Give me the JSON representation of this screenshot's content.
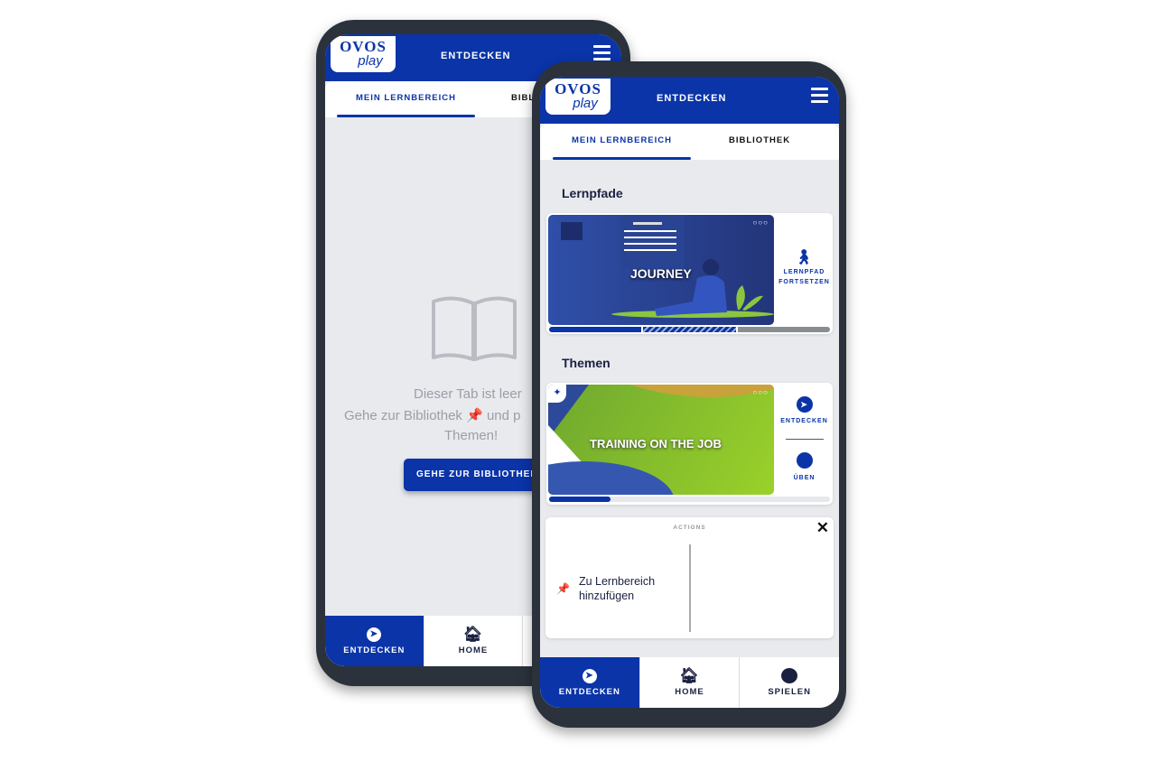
{
  "back_phone": {
    "header": {
      "logo_top": "OVOS",
      "logo_bottom": "play",
      "title": "ENTDECKEN"
    },
    "tabs": [
      {
        "label": "MEIN LERNBEREICH",
        "active": true
      },
      {
        "label": "BIBLIOTHEK",
        "active": false
      }
    ],
    "empty": {
      "line1": "Dieser Tab ist leer",
      "line2a": "Gehe zur Bibliothek",
      "line2b": "und p",
      "line3": "Themen!",
      "icon": "open-book-icon"
    },
    "button": "GEHE ZUR BIBLIOTHEK",
    "nav": [
      {
        "label": "ENTDECKEN",
        "icon": "compass-icon",
        "active": true
      },
      {
        "label": "HOME",
        "icon": "home-icon",
        "active": false
      }
    ]
  },
  "front_phone": {
    "header": {
      "logo_top": "OVOS",
      "logo_bottom": "play",
      "title": "ENTDECKEN"
    },
    "tabs": [
      {
        "label": "MEIN LERNBEREICH",
        "active": true
      },
      {
        "label": "BIBLIOTHEK",
        "active": false
      }
    ],
    "sections": {
      "lernpfade": "Lernpfade",
      "themen": "Themen"
    },
    "journey_card": {
      "title": "JOURNEY",
      "action": "LERNPFAD FORTSETZEN",
      "action_icon": "hiker-icon",
      "progress_segments": [
        "done",
        "in-progress",
        "todo"
      ]
    },
    "topic_card": {
      "title": "TRAINING ON THE JOB",
      "actions": [
        {
          "label": "ENTDECKEN",
          "icon": "compass-icon"
        },
        {
          "label": "ÜBEN",
          "icon": "brain-icon"
        }
      ],
      "progress": 0.22
    },
    "actions_panel": {
      "title": "ACTIONS",
      "item": "Zu Lernbereich hinzufügen",
      "item_icon": "pin-icon"
    },
    "nav": [
      {
        "label": "ENTDECKEN",
        "icon": "compass-icon",
        "active": true
      },
      {
        "label": "HOME",
        "icon": "home-icon",
        "active": false
      },
      {
        "label": "SPIELEN",
        "icon": "brain-icon",
        "active": false
      }
    ]
  },
  "colors": {
    "brand": "#0a34a8",
    "accent_green": "#8cc63f"
  }
}
